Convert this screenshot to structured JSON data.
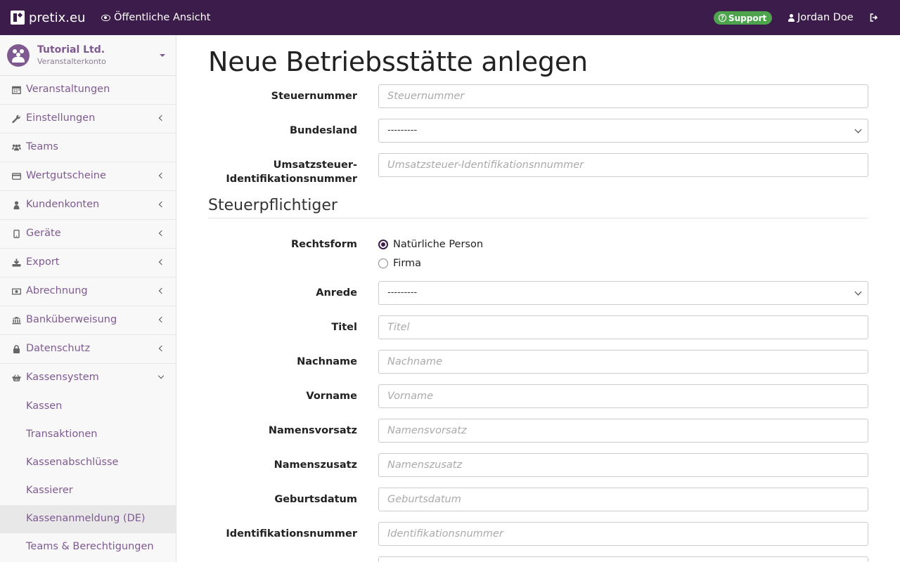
{
  "topbar": {
    "brand": "pretix.eu",
    "public_view": "Öffentliche Ansicht",
    "support": "Support",
    "user": "Jordan Doe",
    "colors": {
      "bar": "#3b1c4a",
      "support": "#4ea44c"
    }
  },
  "sidebar": {
    "org_name": "Tutorial Ltd.",
    "org_sub": "Veranstalterkonto",
    "items": [
      {
        "label": "Veranstaltungen",
        "icon": "calendar-icon"
      },
      {
        "label": "Einstellungen",
        "icon": "wrench-icon"
      },
      {
        "label": "Teams",
        "icon": "users-icon"
      },
      {
        "label": "Wertgutscheine",
        "icon": "credit-card-icon"
      },
      {
        "label": "Kundenkonten",
        "icon": "user-icon"
      },
      {
        "label": "Geräte",
        "icon": "tablet-icon"
      },
      {
        "label": "Export",
        "icon": "download-icon"
      },
      {
        "label": "Abrechnung",
        "icon": "money-icon"
      },
      {
        "label": "Banküberweisung",
        "icon": "bank-icon"
      },
      {
        "label": "Datenschutz",
        "icon": "lock-icon"
      },
      {
        "label": "Kassensystem",
        "icon": "basket-icon"
      }
    ],
    "sub_items": [
      {
        "label": "Kassen"
      },
      {
        "label": "Transaktionen"
      },
      {
        "label": "Kassenabschlüsse"
      },
      {
        "label": "Kassierer"
      },
      {
        "label": "Kassenanmeldung (DE)"
      },
      {
        "label": "Teams & Berechtigungen"
      }
    ]
  },
  "main": {
    "title": "Neue Betriebsstätte anlegen",
    "fields": {
      "steuernummer": {
        "label": "Steuernummer",
        "placeholder": "Steuernummer"
      },
      "bundesland": {
        "label": "Bundesland",
        "value": "---------"
      },
      "ustid": {
        "label_line1": "Umsatzsteuer-",
        "label_line2": "Identifikationsnummer",
        "placeholder": "Umsatzsteuer-Identifikationsnnummer"
      }
    },
    "section_title": "Steuerpflichtiger",
    "rechtsform": {
      "label": "Rechtsform",
      "options": [
        "Natürliche Person",
        "Firma"
      ],
      "selected": "Natürliche Person"
    },
    "person_fields": {
      "anrede": {
        "label": "Anrede",
        "value": "---------"
      },
      "titel": {
        "label": "Titel",
        "placeholder": "Titel"
      },
      "nachname": {
        "label": "Nachname",
        "placeholder": "Nachname"
      },
      "vorname": {
        "label": "Vorname",
        "placeholder": "Vorname"
      },
      "namensvorsatz": {
        "label": "Namensvorsatz",
        "placeholder": "Namensvorsatz"
      },
      "namenszusatz": {
        "label": "Namenszusatz",
        "placeholder": "Namenszusatz"
      },
      "geburtsdatum": {
        "label": "Geburtsdatum",
        "placeholder": "Geburtsdatum"
      },
      "identifikationsnummer": {
        "label": "Identifikationsnummer",
        "placeholder": "Identifikationsnummer"
      }
    }
  }
}
